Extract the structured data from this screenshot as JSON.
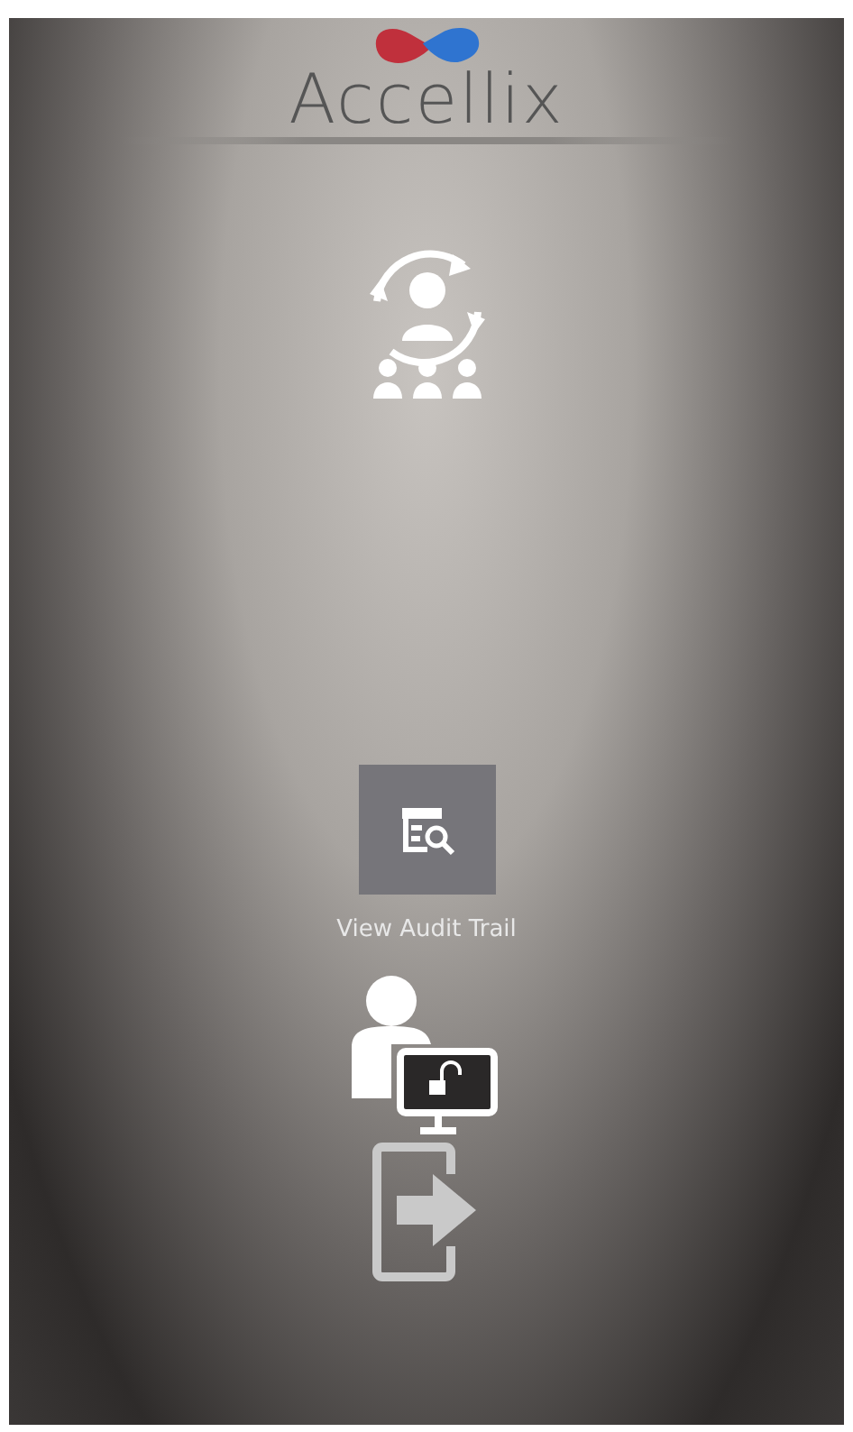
{
  "logo": {
    "text": "Accellix"
  },
  "items": [
    {
      "kind": "switch-user",
      "selected": false
    },
    {
      "kind": "audit",
      "label": "View Audit Trail",
      "selected": true
    },
    {
      "kind": "unlock",
      "selected": false
    },
    {
      "kind": "logout",
      "selected": false
    }
  ]
}
